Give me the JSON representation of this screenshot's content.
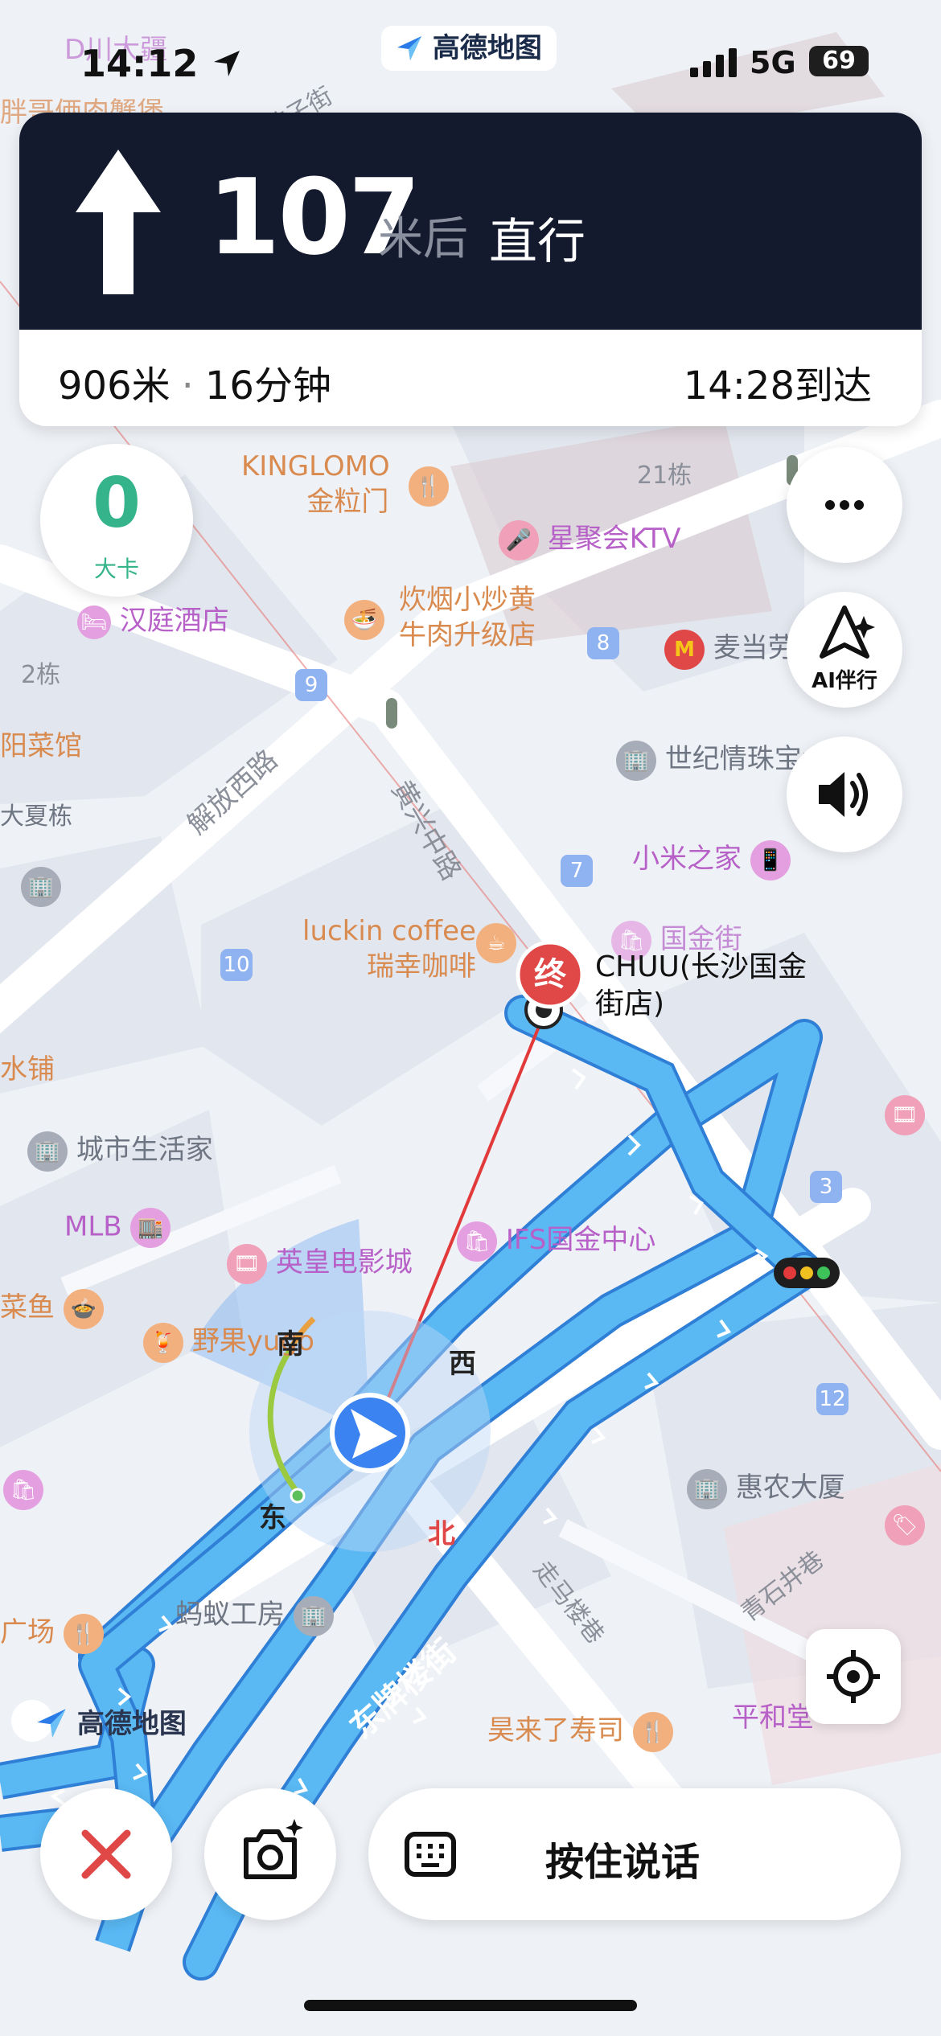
{
  "status_bar": {
    "time": "14:12",
    "app_badge": "高德地图",
    "network": "5G",
    "battery": "69"
  },
  "navigation": {
    "distance": "107",
    "distance_unit": "米后",
    "instruction": "直行",
    "remaining_distance": "906米",
    "separator": "·",
    "remaining_time": "16分钟",
    "arrival": "14:28到达"
  },
  "speed": {
    "value": "0",
    "label": "大卡"
  },
  "side_buttons": {
    "ai_label": "AI伴行"
  },
  "compass": {
    "south": "南",
    "west": "西",
    "east": "东",
    "north": "北"
  },
  "destination": {
    "marker": "终",
    "name_line1": "CHUU(长沙国金",
    "name_line2": "街店)"
  },
  "roads": {
    "jiefang_west": "解放西路",
    "huangxing": "黄兴中路",
    "dongpailou": "东牌楼街",
    "zouma": "走马楼巷",
    "qingshijing": "青石井巷",
    "bifu": "坡子街"
  },
  "road_numbers": [
    "9",
    "8",
    "7",
    "10",
    "3",
    "12"
  ],
  "pois": {
    "kinglomo_en": "KINGLOMO",
    "kinglomo_cn": "金粒门",
    "building21": "21栋",
    "ktv": "星聚会KTV",
    "hanting": "汉庭酒店",
    "chaohuang1": "炊烟小炒黄",
    "chaohuang2": "牛肉升级店",
    "mcd": "麦当劳",
    "building2": "2栋",
    "yangcai": "阳菜馆",
    "dasha": "大夏栋",
    "shiji": "世纪情珠宝大厦",
    "xiaomi": "小米之家",
    "luckin_en": "luckin coffee",
    "luckin_cn": "瑞幸咖啡",
    "guojinjie": "国金街",
    "shuipu": "水铺",
    "chengshi": "城市生活家",
    "mlb": "MLB",
    "ifs": "IFS国金中心",
    "yingfeng": "英皇电影城",
    "caiyu": "菜鱼",
    "yeguo": "野果yugo",
    "huinong": "惠农大厦",
    "guangchang": "广场",
    "mayi": "蚂蚁工房",
    "shoushi": "昊来了寿司",
    "pinghe": "平和堂",
    "top_left": "D川大疆",
    "top_left2": "胖哥俩肉蟹煲"
  },
  "watermark": "高德地图",
  "bottom": {
    "talk_label": "按住说话"
  },
  "colors": {
    "route": "#4fb1f0",
    "nav_bg": "#141a2e",
    "speed_green": "#35b38a",
    "dest_red": "#e04848"
  }
}
